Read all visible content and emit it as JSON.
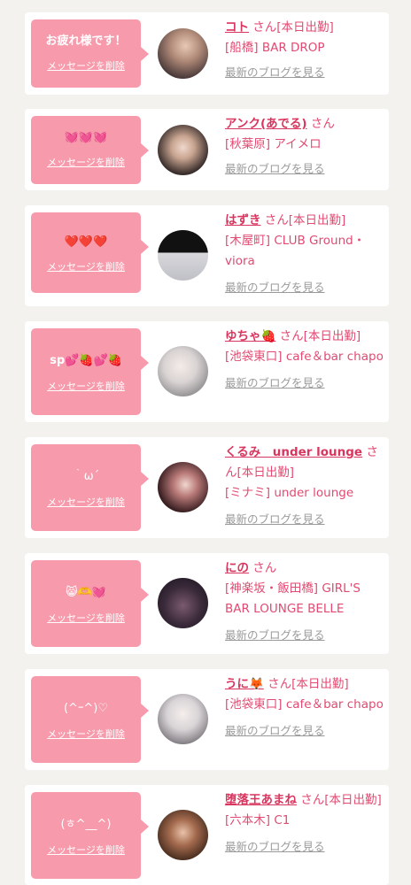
{
  "delete_label": "メッセージを削除",
  "blog_label": "最新のブログを見る",
  "entries": [
    {
      "message": "お疲れ様です！",
      "name": "コト",
      "suffix": " さん[本日出勤]",
      "shop": "[船橋] BAR DROP"
    },
    {
      "message": "💓💓💓",
      "name": "アンク(あでる)",
      "suffix": " さん",
      "shop": "[秋葉原] アイメロ"
    },
    {
      "message": "❤️❤️❤️",
      "name": "はずき",
      "suffix": " さん[本日出勤]",
      "shop": "[木屋町] CLUB Ground・viora"
    },
    {
      "message": "sp💕🍓💕🍓",
      "name": "ゆちゃ🍓",
      "suffix": " さん[本日出勤]",
      "shop": "[池袋東口] cafe＆bar chapo"
    },
    {
      "message": "｀ω´",
      "name": "くるみ　under lounge",
      "suffix": " さん[本日出勤]",
      "shop": "[ミナミ] under lounge"
    },
    {
      "message": "😸🫶💓",
      "name": "にの",
      "suffix": " さん",
      "shop": "[神楽坂・飯田橋] GIRL'S BAR LOUNGE BELLE"
    },
    {
      "message": "(^ｰ^)♡",
      "name": "うに🦊",
      "suffix": " さん[本日出勤]",
      "shop": "[池袋東口] cafe＆bar chapo"
    },
    {
      "message": "(ㅎ^__^)",
      "name": "堕落王あまね",
      "suffix": " さん[本日出勤]",
      "shop": "[六本木] C1"
    }
  ],
  "colors": {
    "background": "#f3f2ee",
    "message_bg": "#f79aab",
    "name": "#d9365f",
    "link_gray": "#9a9a9a"
  }
}
